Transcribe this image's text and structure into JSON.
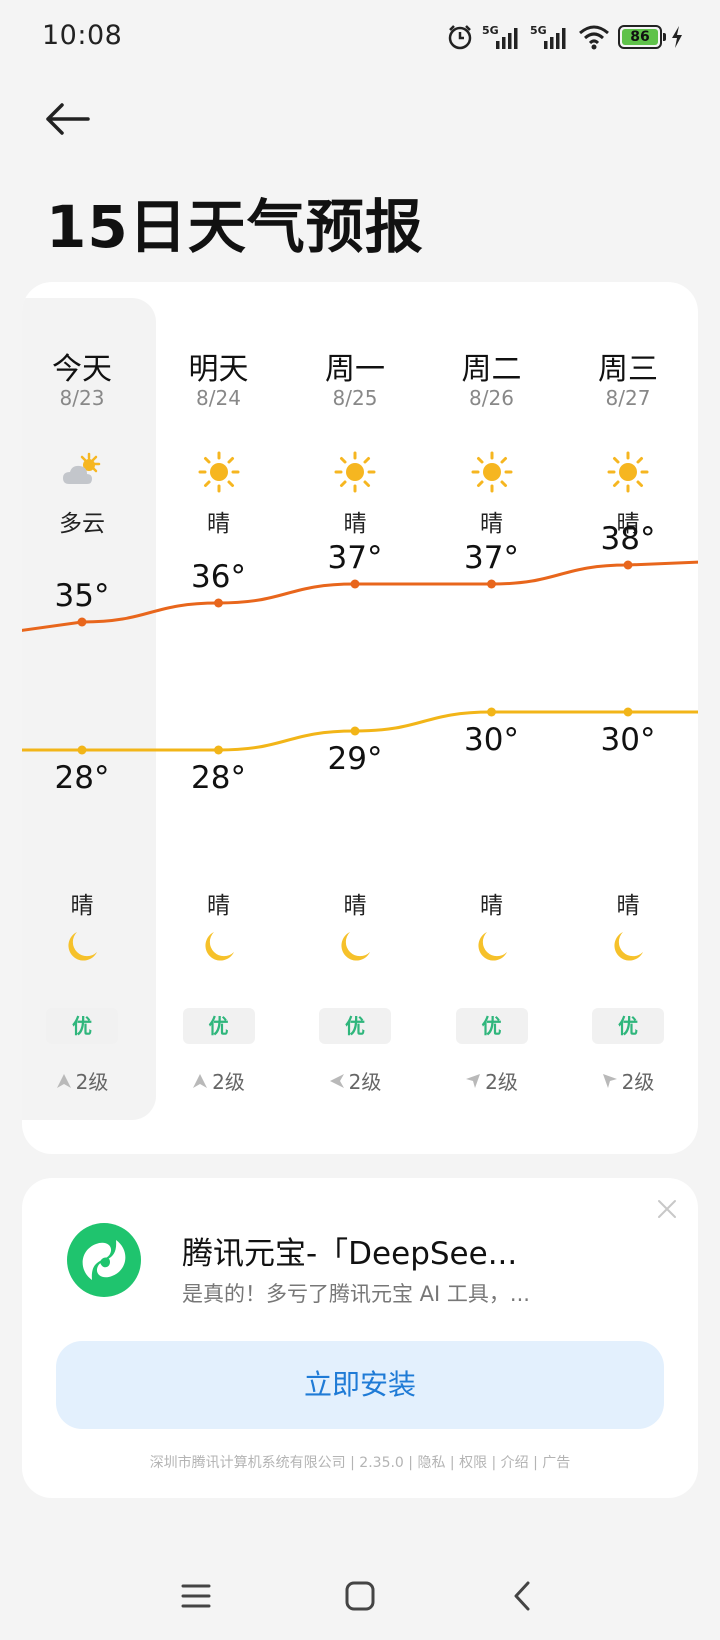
{
  "status_bar": {
    "time": "10:08",
    "battery_level": "86",
    "icons": [
      "alarm-icon",
      "signal-5g-icon",
      "signal-5g-icon",
      "wifi-icon",
      "battery-icon",
      "charging-icon"
    ]
  },
  "header": {
    "back_icon": "arrow-left-icon",
    "title": "15日天气预报"
  },
  "forecast": {
    "days": [
      {
        "name": "今天",
        "date": "8/23",
        "day_condition": "多云",
        "day_icon": "partly-cloudy-icon",
        "high": "35°",
        "low": "28°",
        "high_value": 35,
        "low_value": 28,
        "night_condition": "晴",
        "night_icon": "moon-icon",
        "aqi": "优",
        "wind": "2级",
        "wind_direction": "north"
      },
      {
        "name": "明天",
        "date": "8/24",
        "day_condition": "晴",
        "day_icon": "sun-icon",
        "high": "36°",
        "low": "28°",
        "high_value": 36,
        "low_value": 28,
        "night_condition": "晴",
        "night_icon": "moon-icon",
        "aqi": "优",
        "wind": "2级",
        "wind_direction": "north"
      },
      {
        "name": "周一",
        "date": "8/25",
        "day_condition": "晴",
        "day_icon": "sun-icon",
        "high": "37°",
        "low": "29°",
        "high_value": 37,
        "low_value": 29,
        "night_condition": "晴",
        "night_icon": "moon-icon",
        "aqi": "优",
        "wind": "2级",
        "wind_direction": "west"
      },
      {
        "name": "周二",
        "date": "8/26",
        "day_condition": "晴",
        "day_icon": "sun-icon",
        "high": "37°",
        "low": "30°",
        "high_value": 37,
        "low_value": 30,
        "night_condition": "晴",
        "night_icon": "moon-icon",
        "aqi": "优",
        "wind": "2级",
        "wind_direction": "northeast"
      },
      {
        "name": "周三",
        "date": "8/27",
        "day_condition": "晴",
        "day_icon": "sun-icon",
        "high": "38°",
        "low": "30°",
        "high_value": 38,
        "low_value": 30,
        "night_condition": "晴",
        "night_icon": "moon-icon",
        "aqi": "优",
        "wind": "2级",
        "wind_direction": "southeast"
      }
    ],
    "colors": {
      "high_line": "#e8661c",
      "low_line": "#f2b518",
      "aqi_good": "#2fb67c",
      "sun": "#f6b620",
      "moon": "#f6c12a"
    }
  },
  "ad": {
    "title": "腾讯元宝-「DeepSee...",
    "description": "是真的！多亏了腾讯元宝 AI 工具，...",
    "install_label": "立即安装",
    "footer": "深圳市腾讯计算机系统有限公司 | 2.35.0 | 隐私 | 权限 | 介绍 | 广告",
    "logo_icon": "tencent-yuanbao-logo-icon",
    "close_icon": "close-icon",
    "brand_color": "#1fc46e"
  },
  "nav_bar": {
    "icons": [
      "menu-icon",
      "home-icon",
      "back-icon"
    ]
  }
}
